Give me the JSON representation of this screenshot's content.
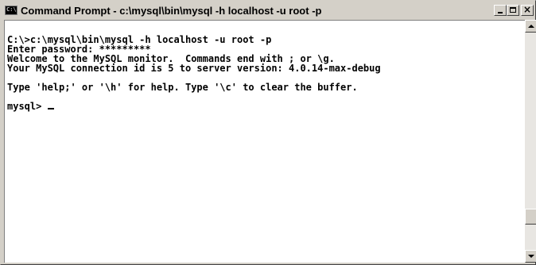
{
  "window": {
    "title": "Command Prompt - c:\\mysql\\bin\\mysql -h localhost -u root -p",
    "icon": "console-icon",
    "icon_label": "C:\\"
  },
  "console": {
    "lines": [
      "C:\\>c:\\mysql\\bin\\mysql -h localhost -u root -p",
      "Enter password: *********",
      "Welcome to the MySQL monitor.  Commands end with ; or \\g.",
      "Your MySQL connection id is 5 to server version: 4.0.14-max-debug",
      "",
      "Type 'help;' or '\\h' for help. Type '\\c' to clear the buffer.",
      "",
      "mysql> "
    ]
  },
  "colors": {
    "window_bg": "#d4d0c8",
    "console_bg": "#ffffff",
    "console_text": "#000000"
  }
}
